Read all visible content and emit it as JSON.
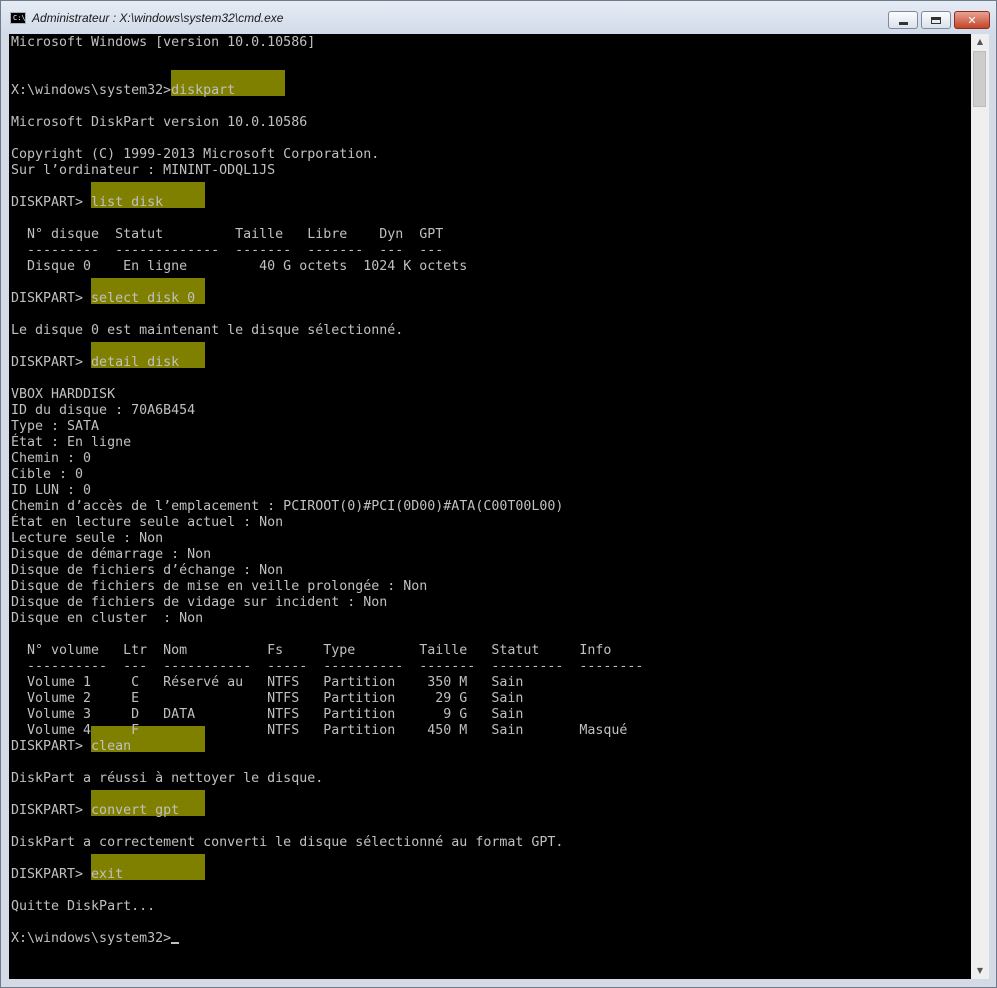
{
  "window": {
    "title": "Administrateur : X:\\windows\\system32\\cmd.exe",
    "icon_text": "C:\\",
    "buttons": {
      "minimize": "minimize-icon",
      "maximize": "maximize-icon",
      "close": "✕"
    }
  },
  "colors": {
    "console_bg": "#000000",
    "console_text": "#c0c0c0",
    "highlight": "#808000"
  },
  "console": {
    "lines": [
      "Microsoft Windows [version 10.0.10586]",
      "",
      "",
      "X:\\windows\\system32>diskpart",
      "",
      "Microsoft DiskPart version 10.0.10586",
      "",
      "Copyright (C) 1999-2013 Microsoft Corporation.",
      "Sur l’ordinateur : MININT-ODQL1JS",
      "",
      "DISKPART> list disk",
      "",
      "  N° disque  Statut         Taille   Libre    Dyn  GPT",
      "  ---------  -------------  -------  -------  ---  ---",
      "  Disque 0    En ligne         40 G octets  1024 K octets",
      "",
      "DISKPART> select disk 0",
      "",
      "Le disque 0 est maintenant le disque sélectionné.",
      "",
      "DISKPART> detail disk",
      "",
      "VBOX HARDDISK",
      "ID du disque : 70A6B454",
      "Type : SATA",
      "État : En ligne",
      "Chemin : 0",
      "Cible : 0",
      "ID LUN : 0",
      "Chemin d’accès de l’emplacement : PCIROOT(0)#PCI(0D00)#ATA(C00T00L00)",
      "État en lecture seule actuel : Non",
      "Lecture seule : Non",
      "Disque de démarrage : Non",
      "Disque de fichiers d’échange : Non",
      "Disque de fichiers de mise en veille prolongée : Non",
      "Disque de fichiers de vidage sur incident : Non",
      "Disque en cluster  : Non",
      "",
      "  N° volume   Ltr  Nom          Fs     Type        Taille   Statut     Info",
      "  ----------  ---  -----------  -----  ----------  -------  ---------  --------",
      "  Volume 1     C   Réservé au   NTFS   Partition    350 M   Sain",
      "  Volume 2     E                NTFS   Partition     29 G   Sain",
      "  Volume 3     D   DATA         NTFS   Partition      9 G   Sain",
      "  Volume 4     F                NTFS   Partition    450 M   Sain       Masqué",
      "DISKPART> clean",
      "",
      "DiskPart a réussi à nettoyer le disque.",
      "",
      "DISKPART> convert gpt",
      "",
      "DiskPart a correctement converti le disque sélectionné au format GPT.",
      "",
      "DISKPART> exit",
      "",
      "Quitte DiskPart...",
      "",
      "X:\\windows\\system32>"
    ]
  },
  "scrollbar": {
    "up": "▲",
    "down": "▼"
  }
}
